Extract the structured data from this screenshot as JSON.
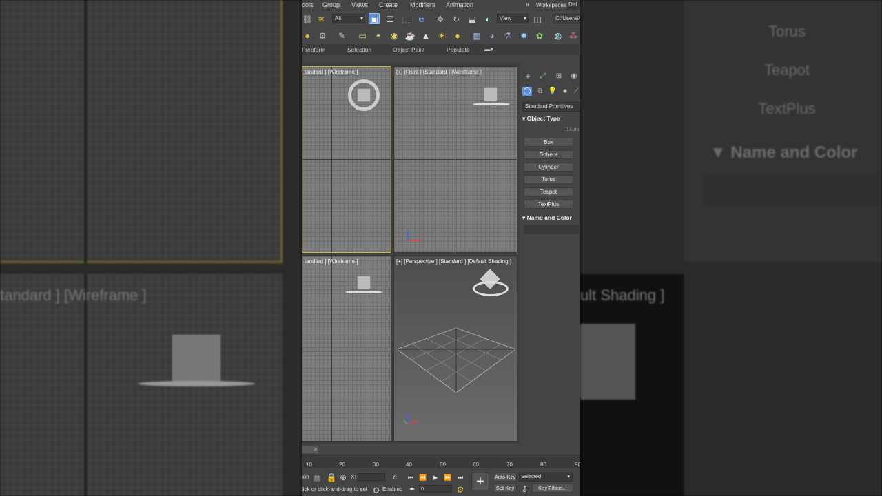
{
  "menu": [
    "ools",
    "Group",
    "Views",
    "Create",
    "Modifiers",
    "Animation"
  ],
  "menu_more": "»",
  "workspaces_label": "Workspaces:",
  "workspaces_value": "Def",
  "toolbar": {
    "filter_value": "All",
    "refcoord_value": "View",
    "path_value": "C:\\Users\\V"
  },
  "ribbon": [
    "Freeform",
    "Selection",
    "Object Paint",
    "Populate"
  ],
  "viewports": {
    "top": "tandard ] [Wireframe ]",
    "front": "[+] [Front ] [Standard ] [Wireframe ]",
    "left": "tandard ] [Wireframe ]",
    "perspective": "[+] [Perspective ] [Standard ] [Default Shading ]"
  },
  "command_panel": {
    "category": "Standard Primitives",
    "object_type": "Object Type",
    "autogrid": "Auto",
    "buttons": [
      "Box",
      "Sphere",
      "Cylinder",
      "Torus",
      "Teapot",
      "TextPlus"
    ],
    "name_and_color": "Name and Color"
  },
  "timeline": {
    "slider": ">",
    "ticks": [
      "10",
      "20",
      "30",
      "40",
      "50",
      "60",
      "70",
      "80",
      "90"
    ]
  },
  "status": {
    "left_label": "ion",
    "prompt": "lick or click-and-drag to sel",
    "x_label": "X:",
    "y_label": "Y:",
    "enabled": "Enabled",
    "frame": "0",
    "auto_key": "Auto Key",
    "set_key": "Set Key",
    "selected": "Selected",
    "key_filters": "Key Filters..."
  },
  "background": {
    "right_buttons": [
      "Torus",
      "Teapot",
      "TextPlus"
    ],
    "right_rollout": "Name and Color",
    "left_label": "tandard ] [Wireframe ]",
    "right_label": "ult Shading ]"
  },
  "colors": {
    "accent_active_viewport": "#c8b84a",
    "select_button": "#5b8fd6"
  }
}
